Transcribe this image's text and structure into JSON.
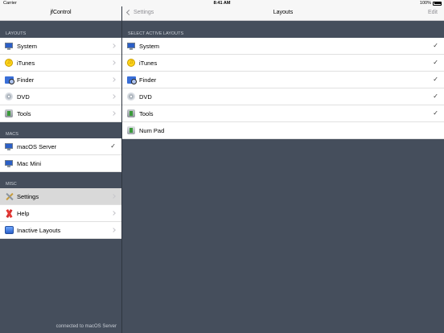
{
  "status_bar": {
    "carrier": "Carrier",
    "time": "8:41 AM",
    "battery": "100%"
  },
  "left_pane": {
    "title": "jfControl",
    "sections": [
      {
        "header": "LAYOUTS",
        "items": [
          {
            "label": "System",
            "icon": "monitor-icon",
            "accessory": "chevron"
          },
          {
            "label": "iTunes",
            "icon": "itunes-icon",
            "accessory": "chevron"
          },
          {
            "label": "Finder",
            "icon": "finder-icon",
            "accessory": "chevron"
          },
          {
            "label": "DVD",
            "icon": "dvd-icon",
            "accessory": "chevron"
          },
          {
            "label": "Tools",
            "icon": "tools-icon",
            "accessory": "chevron"
          }
        ]
      },
      {
        "header": "MACS",
        "items": [
          {
            "label": "macOS Server",
            "icon": "monitor-icon",
            "accessory": "checkmark"
          },
          {
            "label": "Mac Mini",
            "icon": "monitor-icon",
            "accessory": "none"
          }
        ]
      },
      {
        "header": "MISC",
        "items": [
          {
            "label": "Settings",
            "icon": "settings-icon",
            "accessory": "chevron",
            "selected": true
          },
          {
            "label": "Help",
            "icon": "help-icon",
            "accessory": "chevron"
          },
          {
            "label": "Inactive Layouts",
            "icon": "inactive-layouts-icon",
            "accessory": "chevron"
          }
        ]
      }
    ],
    "footer": "connected to macOS Server"
  },
  "right_pane": {
    "back_label": "Settings",
    "title": "Layouts",
    "edit_label": "Edit",
    "section_header": "SELECT ACTIVE LAYOUTS",
    "items": [
      {
        "label": "System",
        "icon": "monitor-icon",
        "checked": true
      },
      {
        "label": "iTunes",
        "icon": "itunes-icon",
        "checked": true
      },
      {
        "label": "Finder",
        "icon": "finder-icon",
        "checked": true
      },
      {
        "label": "DVD",
        "icon": "dvd-icon",
        "checked": true
      },
      {
        "label": "Tools",
        "icon": "tools-icon",
        "checked": true
      },
      {
        "label": "Num Pad",
        "icon": "numpad-icon",
        "checked": false
      }
    ]
  },
  "glyphs": {
    "checkmark": "✓",
    "itunes": "♫"
  }
}
